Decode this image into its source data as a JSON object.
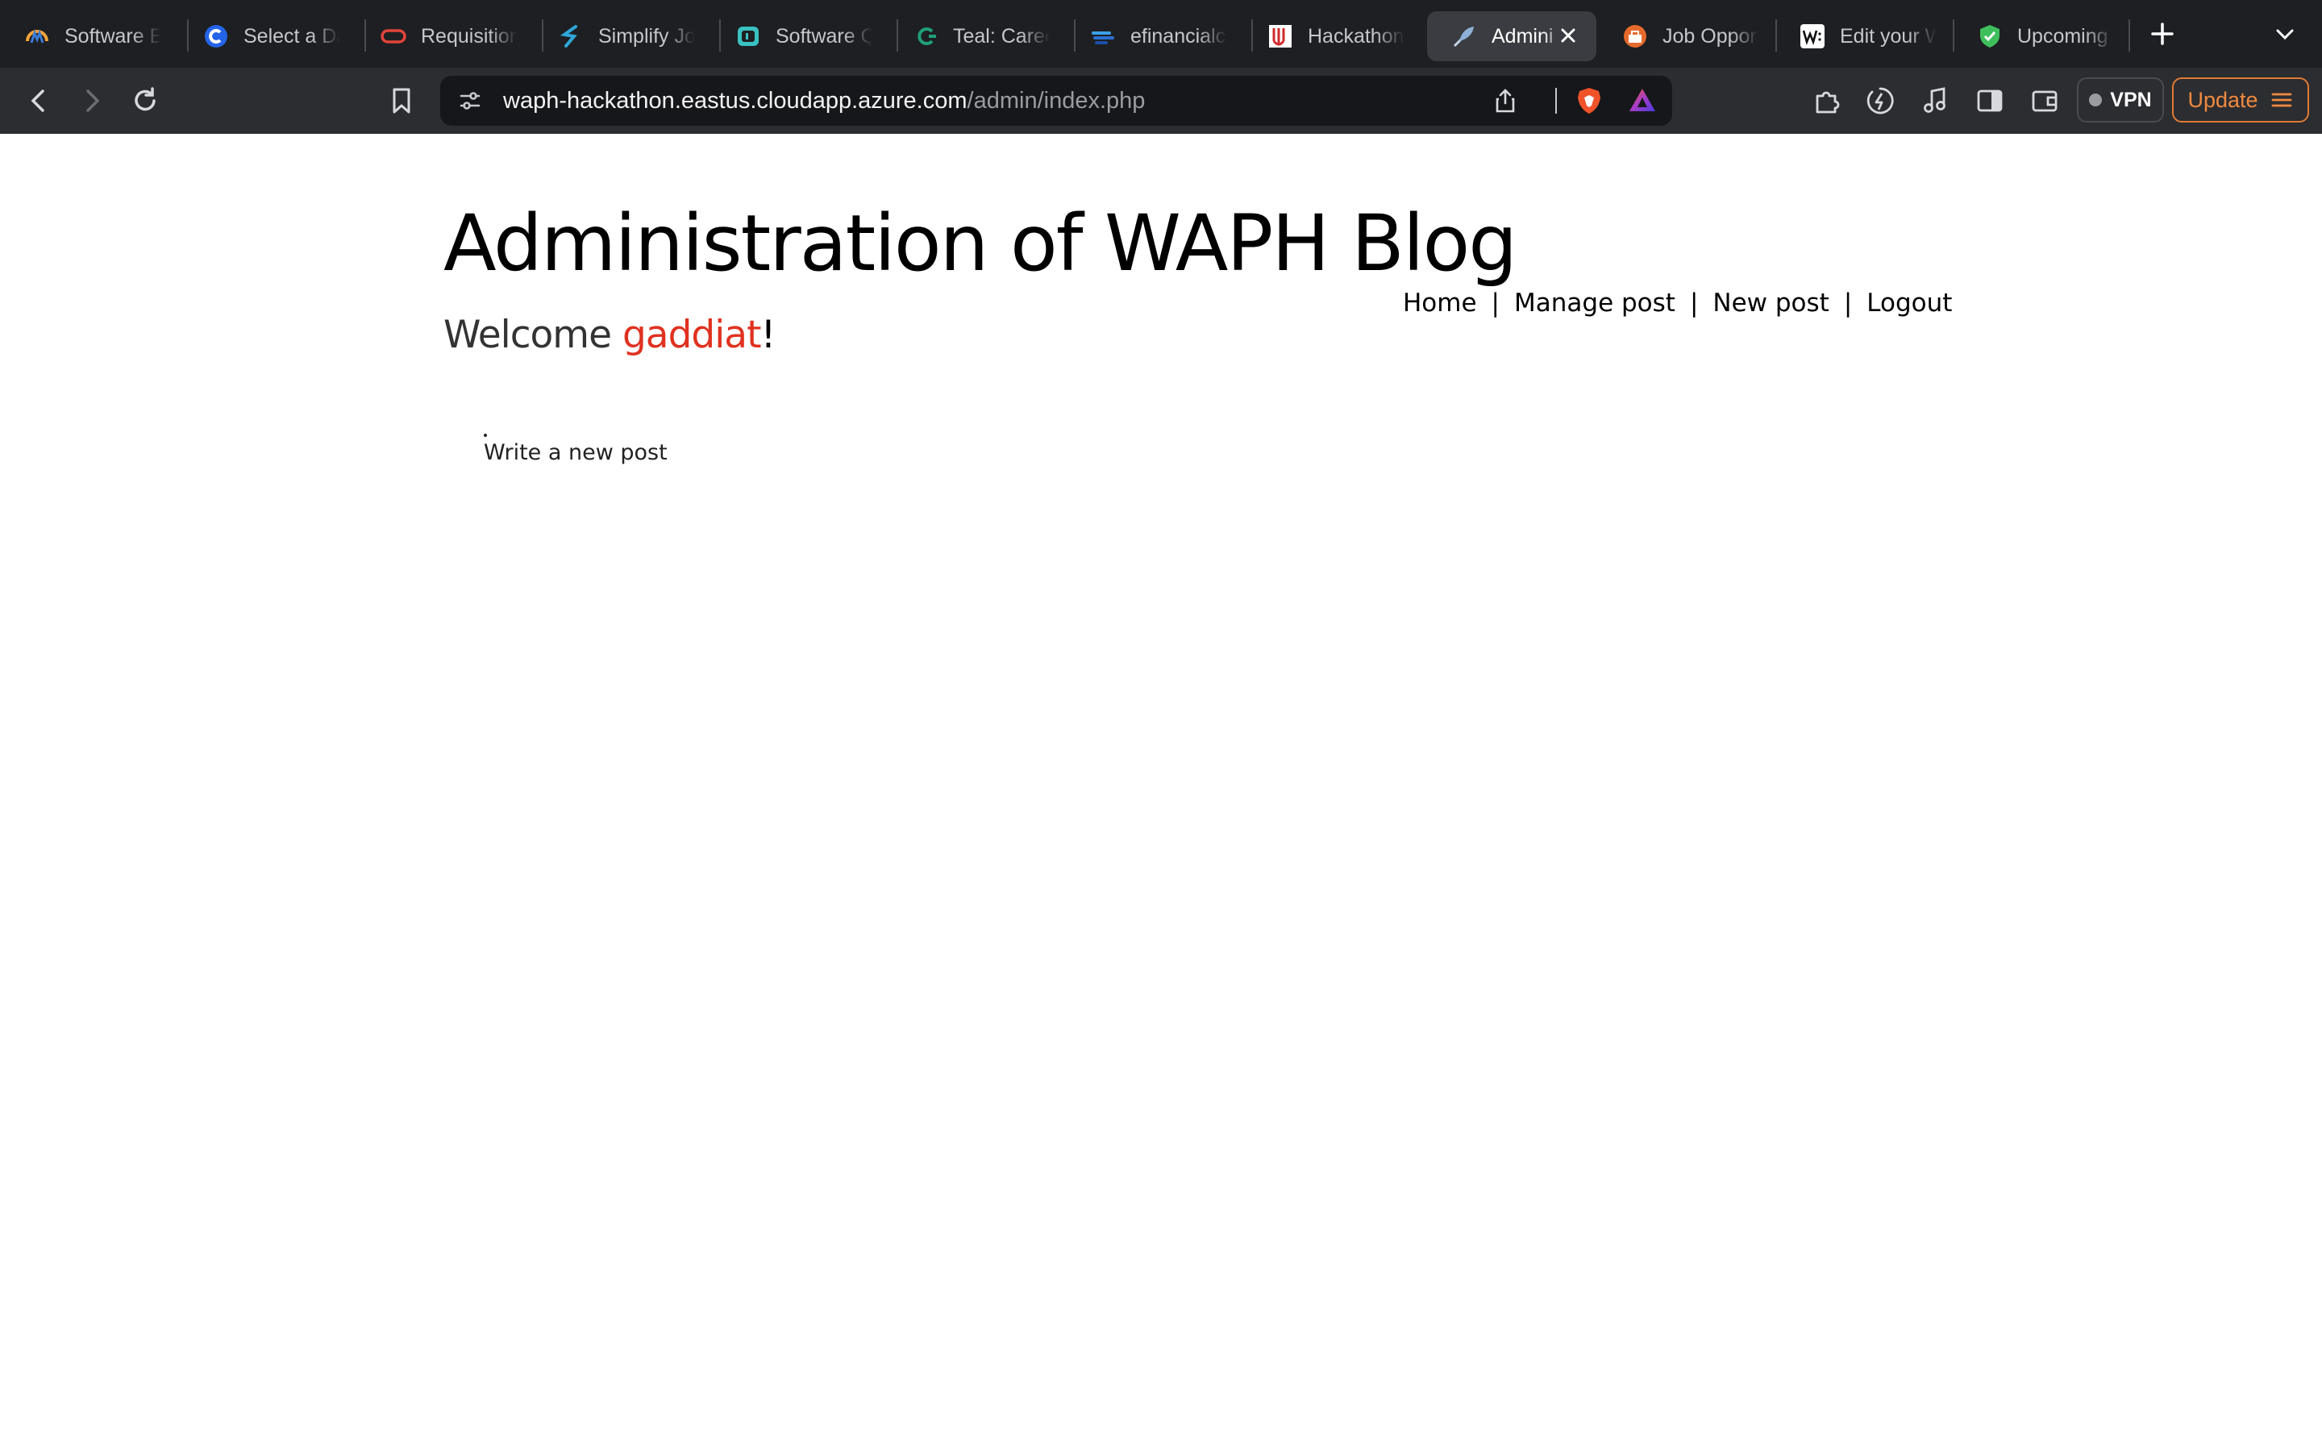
{
  "browser": {
    "tabs": [
      {
        "label": "Software Er",
        "icon": "teal-logo-icon"
      },
      {
        "label": "Select a Da",
        "icon": "calendly-icon"
      },
      {
        "label": "Requisition",
        "icon": "oracle-icon"
      },
      {
        "label": "Simplify Jol",
        "icon": "simplify-icon"
      },
      {
        "label": "Software Q",
        "icon": "tab-app-icon"
      },
      {
        "label": "Teal: Caree",
        "icon": "teal-icon"
      },
      {
        "label": "efinancialc",
        "icon": "efinancial-icon"
      },
      {
        "label": "Hackathon",
        "icon": "university-icon"
      },
      {
        "label": "Admini",
        "icon": "quill-icon",
        "active": true
      },
      {
        "label": "Job Opport",
        "icon": "job-icon"
      },
      {
        "label": "Edit your W",
        "icon": "wordpress-w-icon"
      },
      {
        "label": "Upcoming",
        "icon": "shield-check-icon"
      }
    ],
    "url_host": "waph-hackathon.eastus.cloudapp.azure.com",
    "url_path": "/admin/index.php",
    "vpn_label": "VPN",
    "update_label": "Update",
    "accent_color": "#f08a3f"
  },
  "page": {
    "title": "Administration of WAPH Blog",
    "welcome_prefix": "Welcome ",
    "username": "gaddiat",
    "welcome_suffix": "!",
    "username_color": "#e0311f",
    "nav": {
      "home": "Home",
      "manage_post": "Manage post",
      "new_post": "New post",
      "logout": "Logout",
      "separator": "|"
    },
    "write_new_post": "Write a new post"
  }
}
